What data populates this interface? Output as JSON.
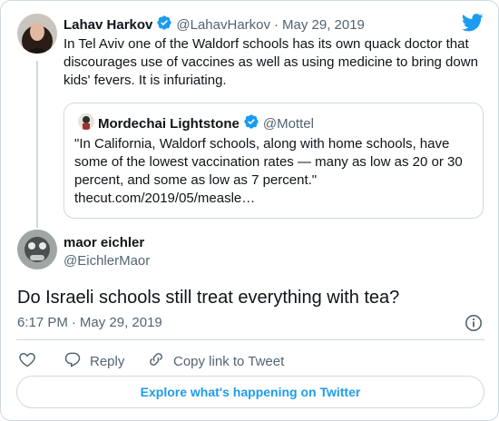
{
  "quoted_reply_parent": {
    "author_name": "Lahav Harkov",
    "handle": "@LahavHarkov",
    "separator": "·",
    "date": "May 29, 2019",
    "text_lines": [
      "In Tel Aviv one of the Waldorf schools has its own quack doctor that",
      "discourages use of vaccines as well as using medicine to bring down",
      "kids' fevers. It is infuriating."
    ],
    "quote": {
      "author_name": "Mordechai Lightstone",
      "handle": "@Mottel",
      "text_lines": [
        "\"In California, Waldorf schools, along with home schools, have",
        "some of the lowest vaccination rates — many as low as 20 or 30",
        "percent, and some as low as 7 percent.\""
      ],
      "link": "thecut.com/2019/05/measle…"
    }
  },
  "tweet": {
    "author_name": "maor eichler",
    "handle": "@EichlerMaor",
    "text": "Do Israeli schools still treat everything with tea?",
    "time": "6:17 PM",
    "separator": "·",
    "date": "May 29, 2019"
  },
  "actions": {
    "reply_label": "Reply",
    "copy_label": "Copy link to Tweet"
  },
  "explore_label": "Explore what's happening on Twitter",
  "colors": {
    "twitter_blue": "#1d9bf0",
    "text": "#0f1419",
    "muted": "#536471",
    "border": "#cfd9de"
  },
  "icons": [
    "twitter-bird-icon",
    "verified-badge-icon",
    "info-icon",
    "like-heart-icon",
    "reply-bubble-icon",
    "link-icon"
  ]
}
